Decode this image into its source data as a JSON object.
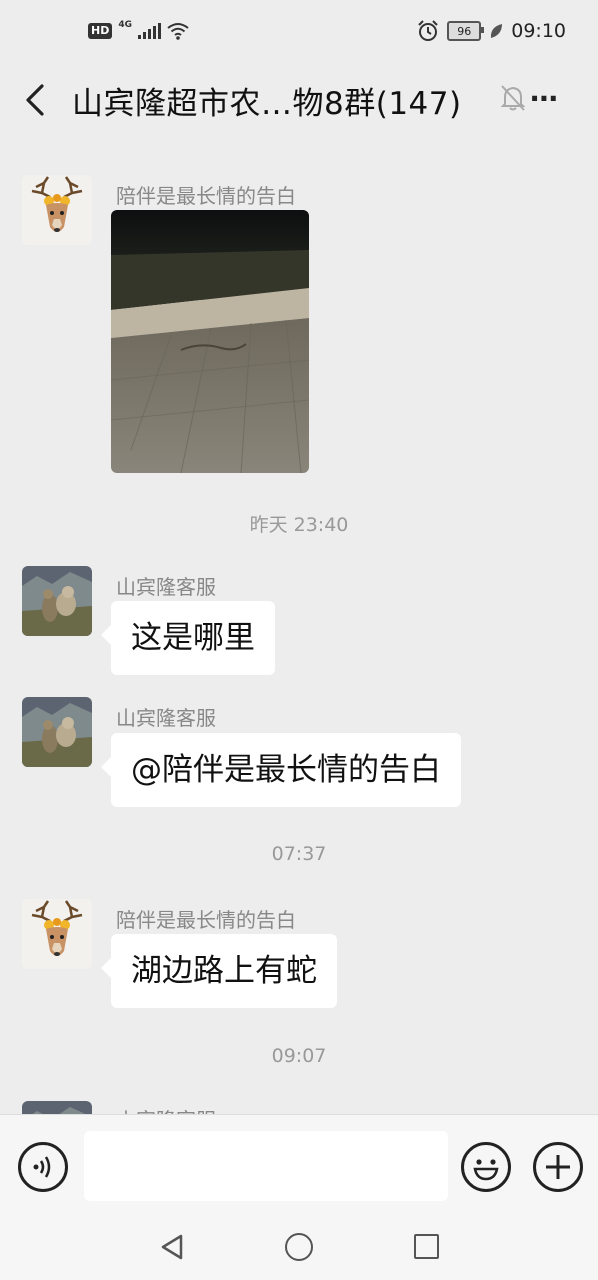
{
  "status_bar": {
    "hd": "HD",
    "network": "4G",
    "battery": "96",
    "time": "09:10"
  },
  "header": {
    "title": "山宾隆超市农…物8群(147)"
  },
  "messages": [
    {
      "sender": "陪伴是最长情的告白",
      "type": "image"
    },
    {
      "timestamp": "昨天 23:40"
    },
    {
      "sender": "山宾隆客服",
      "text": "这是哪里"
    },
    {
      "sender": "山宾隆客服",
      "text": "@陪伴是最长情的告白"
    },
    {
      "timestamp": "07:37"
    },
    {
      "sender": "陪伴是最长情的告白",
      "text": "湖边路上有蛇"
    },
    {
      "timestamp": "09:07"
    },
    {
      "sender": "山宾隆客服",
      "partial": true
    }
  ],
  "icons": {
    "back": "back-arrow-icon",
    "mute": "bell-muted-icon",
    "more": "more-icon",
    "voice": "voice-icon",
    "emoji": "emoji-icon",
    "plus": "plus-icon"
  }
}
